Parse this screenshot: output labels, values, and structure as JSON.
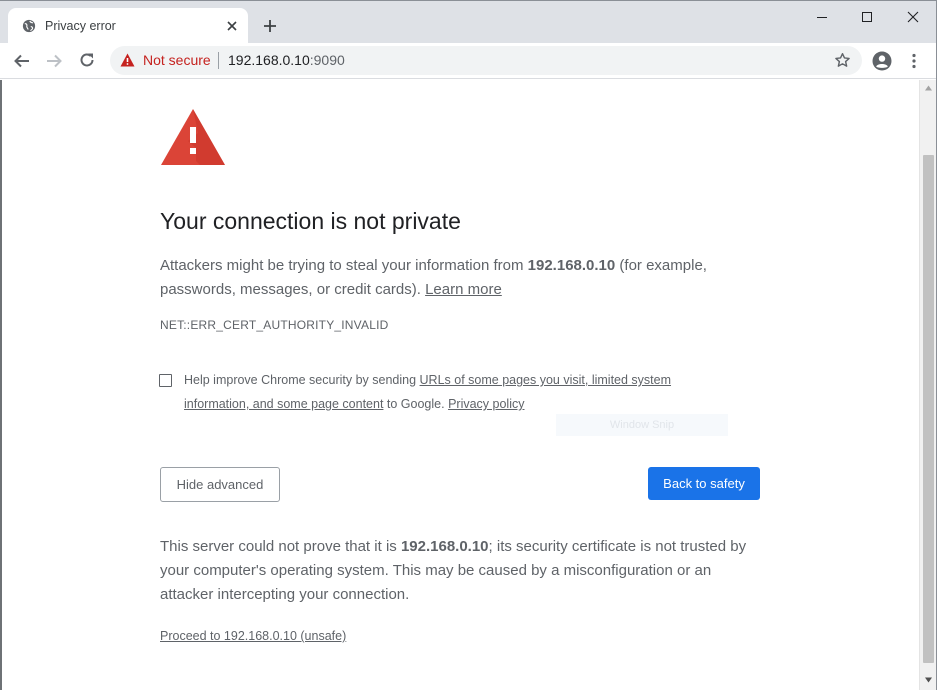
{
  "tab": {
    "title": "Privacy error",
    "favicon": "globe-icon"
  },
  "window_controls": [
    "minimize-icon",
    "maximize-icon",
    "close-icon"
  ],
  "omnibox": {
    "security_label": "Not secure",
    "host": "192.168.0.10",
    "port": ":9090"
  },
  "interstitial": {
    "heading": "Your connection is not private",
    "intro_before": "Attackers might be trying to steal your information from ",
    "intro_host": "192.168.0.10",
    "intro_after": " (for example, passwords, messages, or credit cards). ",
    "learn_more": "Learn more",
    "error_code": "NET::ERR_CERT_AUTHORITY_INVALID",
    "optin_before": "Help improve Chrome security by sending ",
    "optin_link": "URLs of some pages you visit, limited system information, and some page content",
    "optin_after": " to Google. ",
    "privacy_policy": "Privacy policy",
    "snip_overlay": "Window Snip",
    "hide_advanced": "Hide advanced",
    "back_to_safety": "Back to safety",
    "details_before": "This server could not prove that it is ",
    "details_host": "192.168.0.10",
    "details_after": "; its security certificate is not trusted by your computer's operating system. This may be caused by a misconfiguration or an attacker intercepting your connection.",
    "proceed_link": "Proceed to 192.168.0.10 (unsafe)"
  },
  "colors": {
    "warning_red": "#db4437",
    "not_secure_red": "#c5221f",
    "primary_button": "#1a73e8",
    "text_gray": "#5f6368"
  }
}
